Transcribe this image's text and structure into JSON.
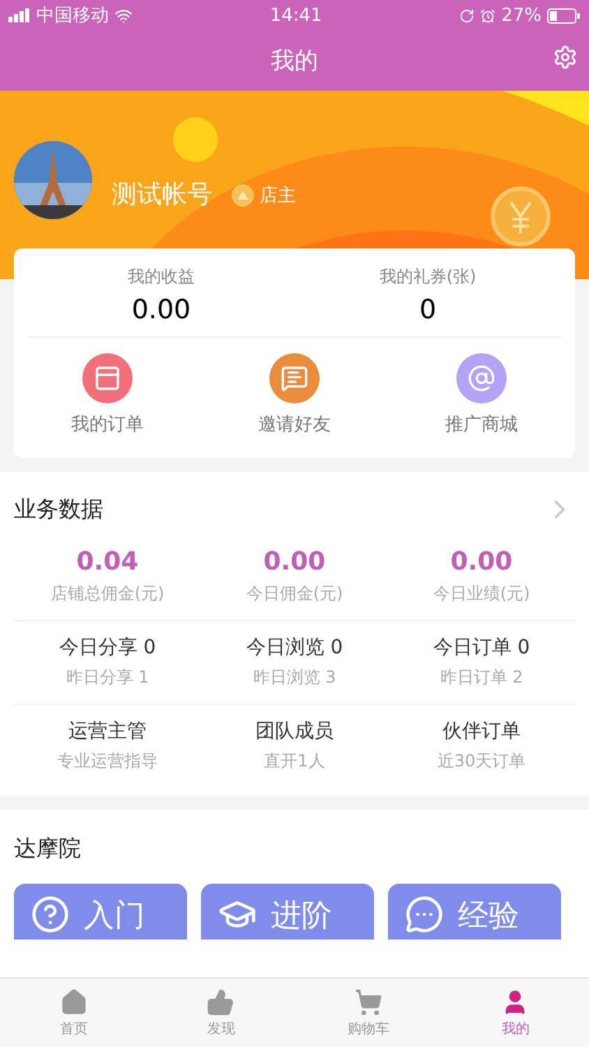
{
  "status_bar": {
    "carrier": "中国移动",
    "time": "14:41",
    "battery": "27%"
  },
  "nav": {
    "title": "我的"
  },
  "profile": {
    "name": "测试帐号",
    "role": "店主"
  },
  "stats": [
    {
      "label": "我的收益",
      "value": "0.00"
    },
    {
      "label": "我的礼券(张)",
      "value": "0"
    }
  ],
  "shortcuts": [
    {
      "label": "我的订单",
      "kind": "orders"
    },
    {
      "label": "邀请好友",
      "kind": "invite"
    },
    {
      "label": "推广商城",
      "kind": "mall"
    }
  ],
  "business": {
    "title": "业务数据",
    "metrics": [
      {
        "value": "0.04",
        "label": "店铺总佣金(元)"
      },
      {
        "value": "0.00",
        "label": "今日佣金(元)"
      },
      {
        "value": "0.00",
        "label": "今日业绩(元)"
      }
    ],
    "activity": [
      {
        "today": "今日分享 0",
        "yesterday": "昨日分享 1"
      },
      {
        "today": "今日浏览 0",
        "yesterday": "昨日浏览 3"
      },
      {
        "today": "今日订单 0",
        "yesterday": "昨日订单 2"
      }
    ],
    "links": [
      {
        "title": "运营主管",
        "sub": "专业运营指导"
      },
      {
        "title": "团队成员",
        "sub": "直开1人"
      },
      {
        "title": "伙伴订单",
        "sub": "近30天订单"
      }
    ]
  },
  "academy": {
    "title": "达摩院",
    "buttons": [
      {
        "label": "入门",
        "kind": "question"
      },
      {
        "label": "进阶",
        "kind": "cap"
      },
      {
        "label": "经验",
        "kind": "chat"
      }
    ]
  },
  "tabs": [
    {
      "label": "首页",
      "kind": "home",
      "selected": false
    },
    {
      "label": "发现",
      "kind": "discover",
      "selected": false
    },
    {
      "label": "购物车",
      "kind": "cart",
      "selected": false
    },
    {
      "label": "我的",
      "kind": "me",
      "selected": true
    }
  ]
}
